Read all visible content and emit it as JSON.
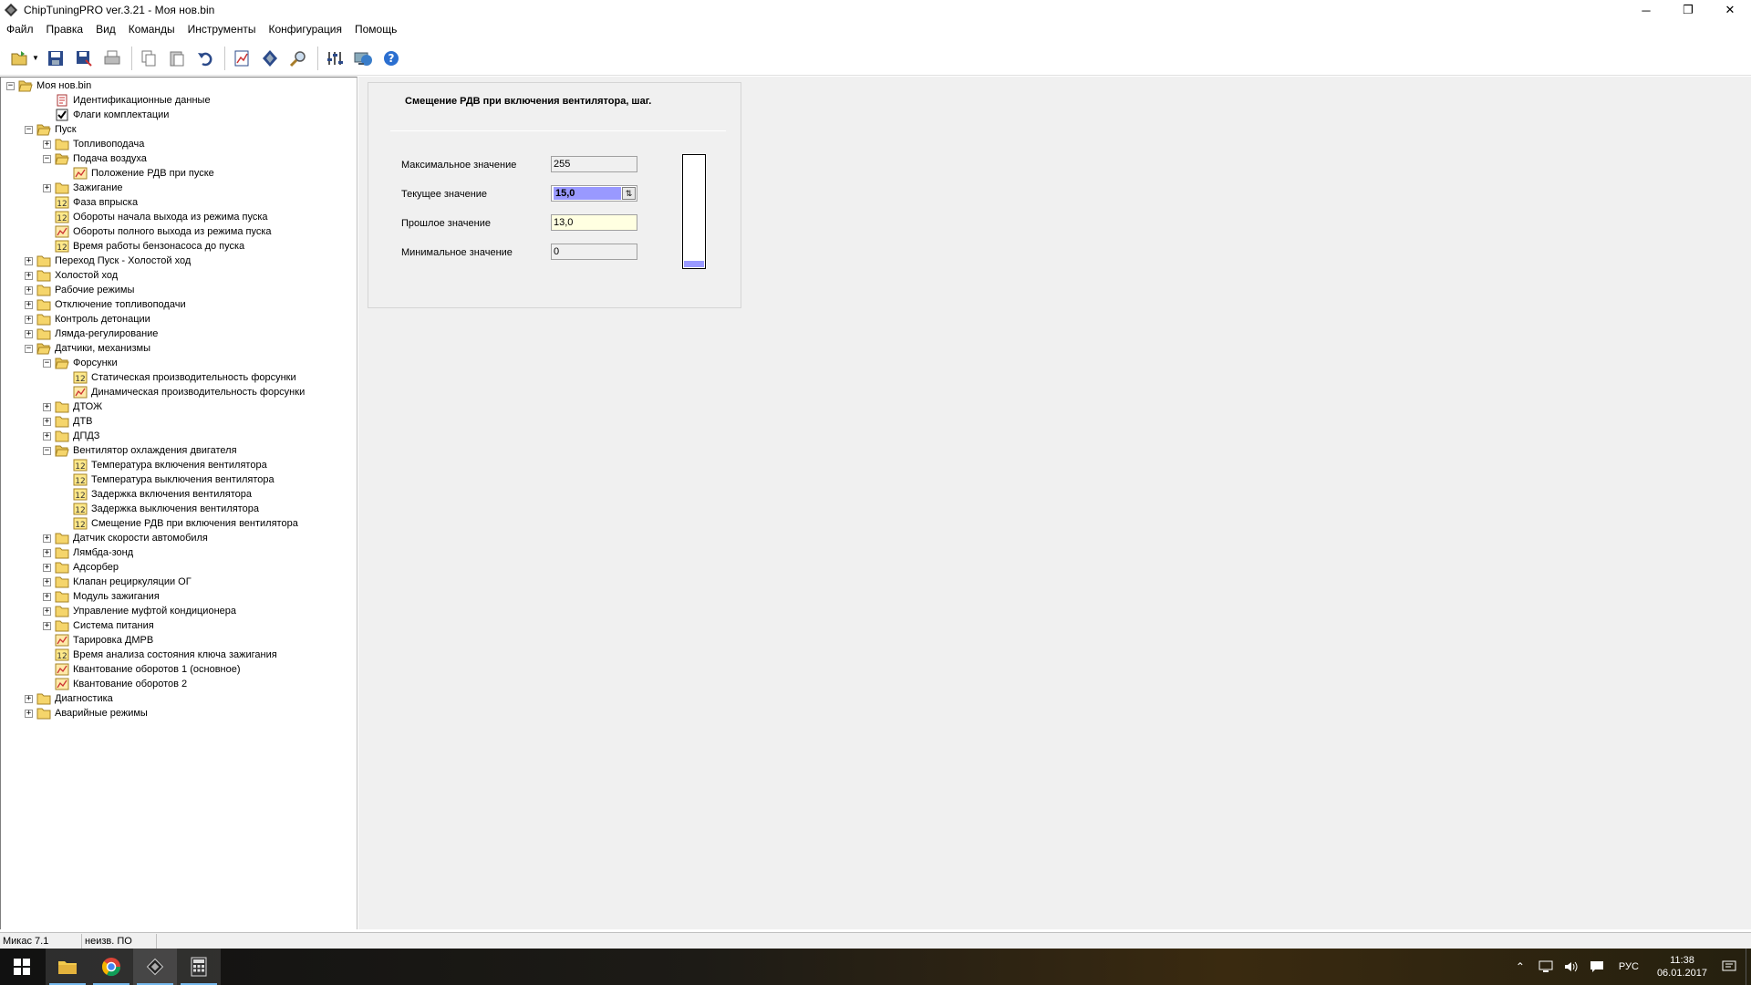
{
  "window": {
    "title": "ChipTuningPRO ver.3.21 - Моя нов.bin",
    "minimize": "─",
    "restore": "❐",
    "close": "✕"
  },
  "menu": [
    "Файл",
    "Правка",
    "Вид",
    "Команды",
    "Инструменты",
    "Конфигурация",
    "Помощь"
  ],
  "tree": [
    {
      "label": "Моя нов.bin",
      "level": 0,
      "exp": "−",
      "icon": "folder-open-icon"
    },
    {
      "label": "Идентификационные данные",
      "level": 2,
      "exp": "",
      "icon": "document-icon"
    },
    {
      "label": "Флаги комплектации",
      "level": 2,
      "exp": "",
      "icon": "checkbox-icon"
    },
    {
      "label": "Пуск",
      "level": 1,
      "exp": "−",
      "icon": "folder-open-icon"
    },
    {
      "label": "Топливоподача",
      "level": 2,
      "exp": "+",
      "icon": "folder-icon"
    },
    {
      "label": "Подача воздуха",
      "level": 2,
      "exp": "−",
      "icon": "folder-open-icon"
    },
    {
      "label": "Положение РДВ при пуске",
      "level": 3,
      "exp": "",
      "icon": "chart-icon"
    },
    {
      "label": "Зажигание",
      "level": 2,
      "exp": "+",
      "icon": "folder-icon"
    },
    {
      "label": "Фаза впрыска",
      "level": 2,
      "exp": "",
      "icon": "value-icon"
    },
    {
      "label": "Обороты начала выхода из режима пуска",
      "level": 2,
      "exp": "",
      "icon": "value-icon"
    },
    {
      "label": "Обороты полного выхода из режима пуска",
      "level": 2,
      "exp": "",
      "icon": "chart-icon"
    },
    {
      "label": "Время работы бензонасоса до пуска",
      "level": 2,
      "exp": "",
      "icon": "value-icon"
    },
    {
      "label": "Переход Пуск - Холостой ход",
      "level": 1,
      "exp": "+",
      "icon": "folder-icon"
    },
    {
      "label": "Холостой ход",
      "level": 1,
      "exp": "+",
      "icon": "folder-icon"
    },
    {
      "label": "Рабочие режимы",
      "level": 1,
      "exp": "+",
      "icon": "folder-icon"
    },
    {
      "label": "Отключение топливоподачи",
      "level": 1,
      "exp": "+",
      "icon": "folder-icon"
    },
    {
      "label": "Контроль детонации",
      "level": 1,
      "exp": "+",
      "icon": "folder-icon"
    },
    {
      "label": "Лямда-регулирование",
      "level": 1,
      "exp": "+",
      "icon": "folder-icon"
    },
    {
      "label": "Датчики, механизмы",
      "level": 1,
      "exp": "−",
      "icon": "folder-open-icon"
    },
    {
      "label": "Форсунки",
      "level": 2,
      "exp": "−",
      "icon": "folder-open-icon"
    },
    {
      "label": "Статическая производительность форсунки",
      "level": 3,
      "exp": "",
      "icon": "value-icon"
    },
    {
      "label": "Динамическая производительность форсунки",
      "level": 3,
      "exp": "",
      "icon": "chart-icon"
    },
    {
      "label": "ДТОЖ",
      "level": 2,
      "exp": "+",
      "icon": "folder-icon"
    },
    {
      "label": "ДТВ",
      "level": 2,
      "exp": "+",
      "icon": "folder-icon"
    },
    {
      "label": "ДПДЗ",
      "level": 2,
      "exp": "+",
      "icon": "folder-icon"
    },
    {
      "label": "Вентилятор охлаждения двигателя",
      "level": 2,
      "exp": "−",
      "icon": "folder-open-icon"
    },
    {
      "label": "Температура включения вентилятора",
      "level": 3,
      "exp": "",
      "icon": "value-icon"
    },
    {
      "label": "Температура выключения вентилятора",
      "level": 3,
      "exp": "",
      "icon": "value-icon"
    },
    {
      "label": "Задержка включения вентилятора",
      "level": 3,
      "exp": "",
      "icon": "value-icon"
    },
    {
      "label": "Задержка выключения вентилятора",
      "level": 3,
      "exp": "",
      "icon": "value-icon"
    },
    {
      "label": "Смещение РДВ при включения вентилятора",
      "level": 3,
      "exp": "",
      "icon": "value-icon"
    },
    {
      "label": "Датчик скорости автомобиля",
      "level": 2,
      "exp": "+",
      "icon": "folder-icon"
    },
    {
      "label": "Лямбда-зонд",
      "level": 2,
      "exp": "+",
      "icon": "folder-icon"
    },
    {
      "label": "Адсорбер",
      "level": 2,
      "exp": "+",
      "icon": "folder-icon"
    },
    {
      "label": "Клапан рециркуляции ОГ",
      "level": 2,
      "exp": "+",
      "icon": "folder-icon"
    },
    {
      "label": "Модуль зажигания",
      "level": 2,
      "exp": "+",
      "icon": "folder-icon"
    },
    {
      "label": "Управление муфтой кондиционера",
      "level": 2,
      "exp": "+",
      "icon": "folder-icon"
    },
    {
      "label": "Система питания",
      "level": 2,
      "exp": "+",
      "icon": "folder-icon"
    },
    {
      "label": "Тарировка ДМРВ",
      "level": 2,
      "exp": "",
      "icon": "chart-icon"
    },
    {
      "label": "Время анализа состояния ключа зажигания",
      "level": 2,
      "exp": "",
      "icon": "value-icon"
    },
    {
      "label": "Квантование оборотов 1 (основное)",
      "level": 2,
      "exp": "",
      "icon": "chart-icon"
    },
    {
      "label": "Квантование оборотов 2",
      "level": 2,
      "exp": "",
      "icon": "chart-icon"
    },
    {
      "label": "Диагностика",
      "level": 1,
      "exp": "+",
      "icon": "folder-icon"
    },
    {
      "label": "Аварийные режимы",
      "level": 1,
      "exp": "+",
      "icon": "folder-icon"
    }
  ],
  "param": {
    "title": "Смещение РДВ при включения вентилятора, шаг.",
    "max_label": "Максимальное значение",
    "max_value": "255",
    "current_label": "Текущее значение",
    "current_value": "15,0",
    "prev_label": "Прошлое значение",
    "prev_value": "13,0",
    "min_label": "Минимальное значение",
    "min_value": "0",
    "gauge_fraction": 0.059,
    "gauge_color": "#9999ff"
  },
  "status": {
    "ecu": "Микас 7.1",
    "software": "неизв. ПО"
  },
  "taskbar": {
    "lang": "РУС",
    "time": "11:38",
    "date": "06.01.2017"
  },
  "colors": {
    "folder": "#f5d56b",
    "accent": "#9999ff"
  }
}
